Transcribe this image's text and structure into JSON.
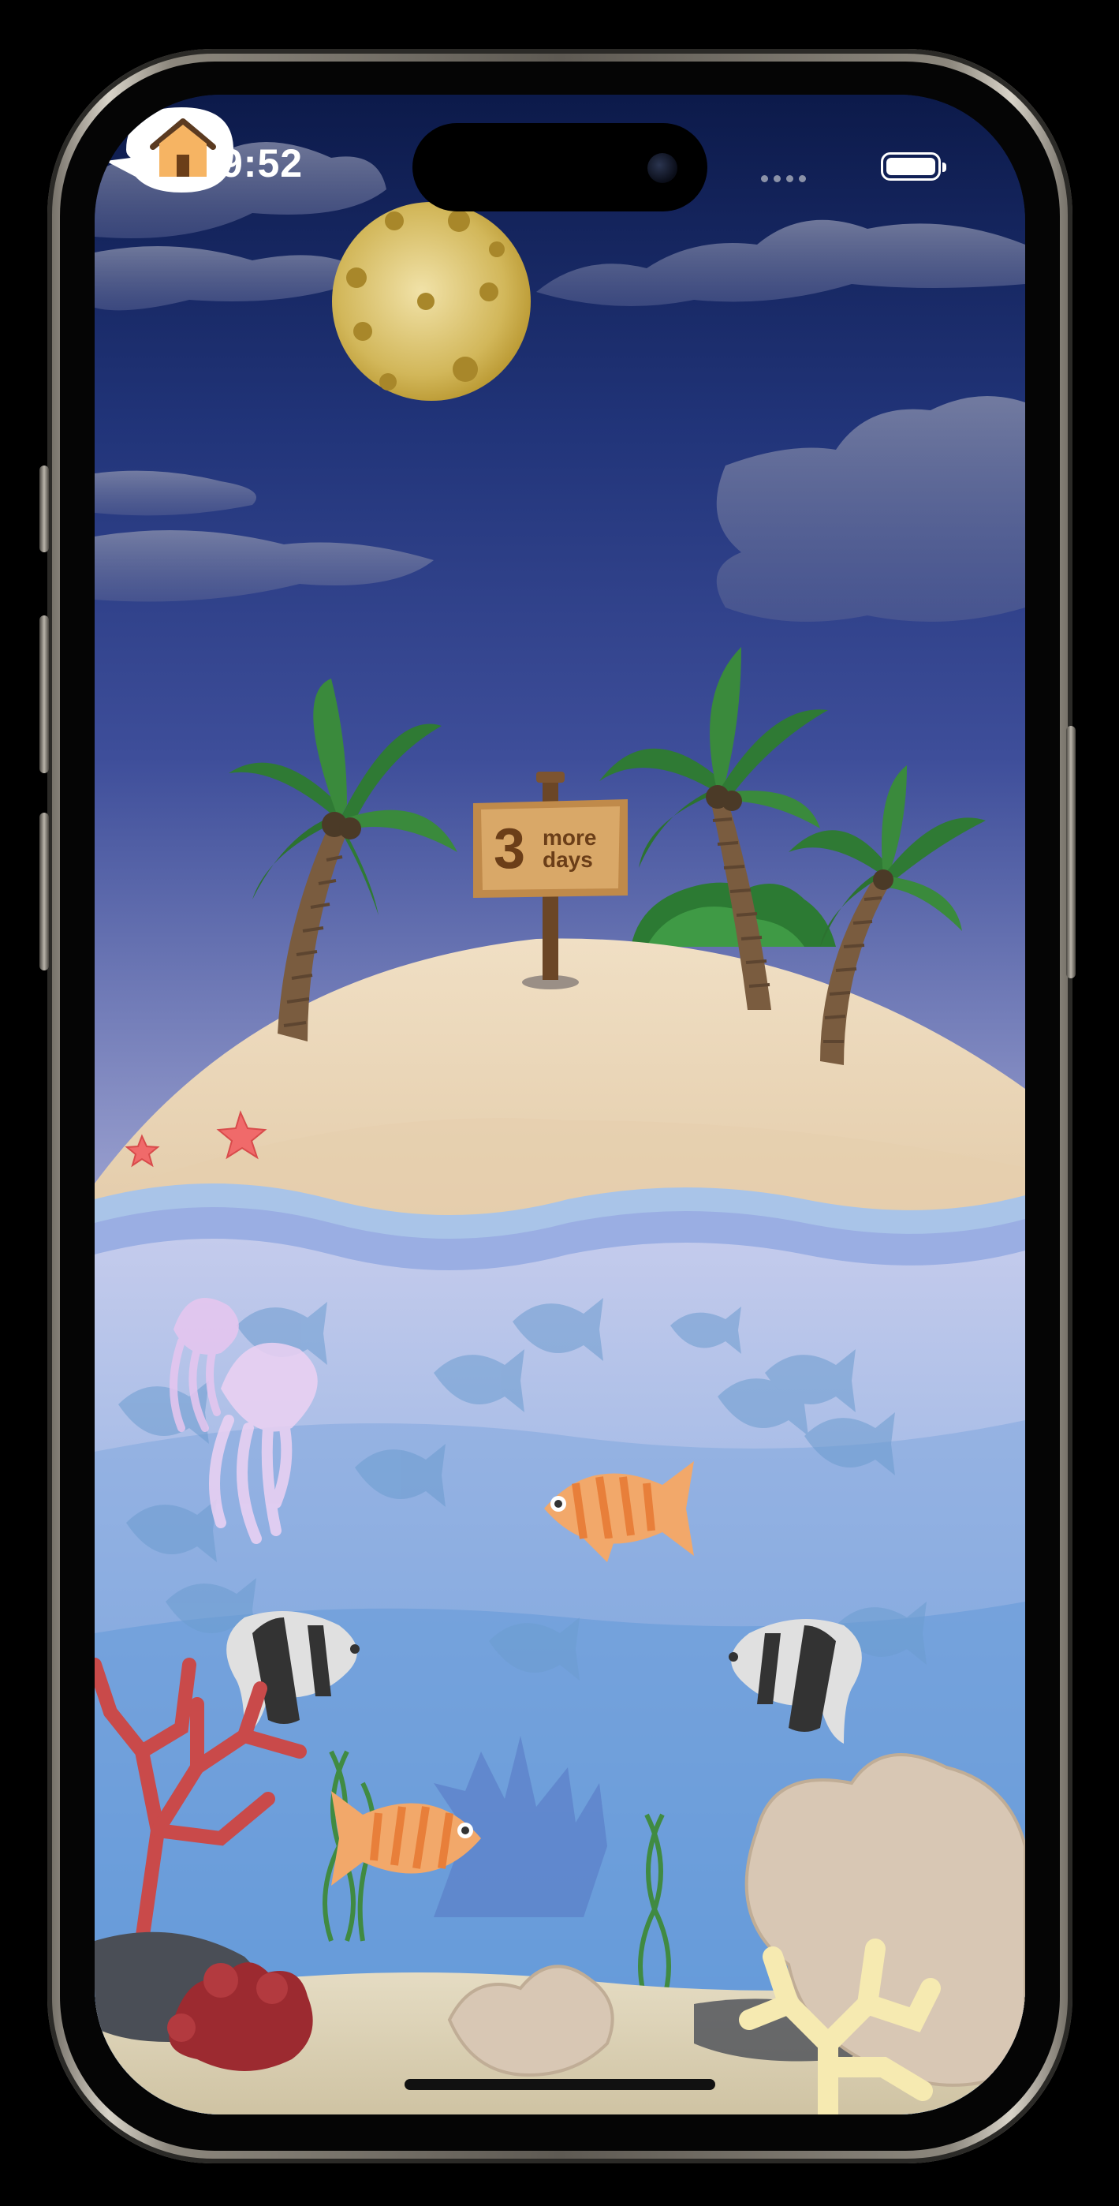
{
  "status_bar": {
    "time": "9:52"
  },
  "sign": {
    "number": "3",
    "line1": "more",
    "line2": "days"
  },
  "home_bubble": {
    "icon": "house-icon"
  },
  "colors": {
    "sky_top": "#0d1b4b",
    "sky_mid": "#2b3f8f",
    "sky_bottom": "#8f96c9",
    "sand": "#e8d3b5",
    "water_top": "#b9c3ea",
    "water_bottom": "#4f8fd6",
    "moon": "#c9a93a",
    "palm_leaf": "#2f7a34"
  }
}
